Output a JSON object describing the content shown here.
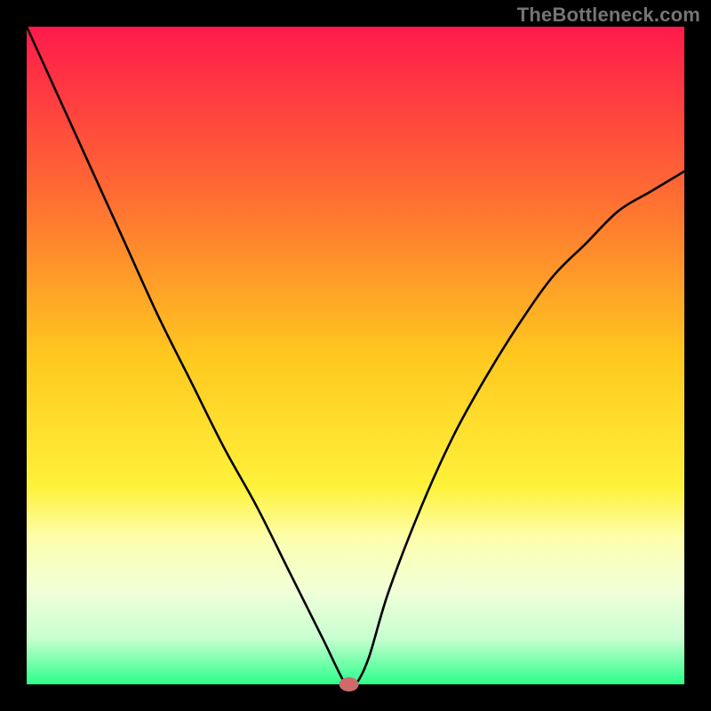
{
  "attribution": "TheBottleneck.com",
  "chart_data": {
    "type": "line",
    "title": "",
    "xlabel": "",
    "ylabel": "",
    "xlim": [
      0,
      100
    ],
    "ylim": [
      0,
      100
    ],
    "x": [
      0,
      5,
      10,
      15,
      20,
      25,
      30,
      35,
      40,
      45,
      48.5,
      50,
      52,
      55,
      60,
      65,
      70,
      75,
      80,
      85,
      90,
      95,
      100
    ],
    "values": [
      100,
      89,
      78,
      67,
      56,
      46,
      36,
      27,
      17,
      7,
      0,
      0,
      4,
      14,
      27,
      38,
      47,
      55,
      62,
      67,
      72,
      75,
      78
    ],
    "marker": {
      "x": 49,
      "y": 0
    },
    "gradient_stops": [
      {
        "pos": 0.0,
        "color": "#ff1a4b"
      },
      {
        "pos": 0.25,
        "color": "#ff6a33"
      },
      {
        "pos": 0.5,
        "color": "#ffc81f"
      },
      {
        "pos": 0.7,
        "color": "#fff23a"
      },
      {
        "pos": 0.78,
        "color": "#fdffb0"
      },
      {
        "pos": 0.86,
        "color": "#f0ffd8"
      },
      {
        "pos": 0.93,
        "color": "#c8ffd0"
      },
      {
        "pos": 1.0,
        "color": "#2bff8a"
      }
    ],
    "plot_border_px": 30,
    "curve_stroke": "#000000",
    "curve_stroke_width": 2.6,
    "marker_fill": "#cf6a6a"
  }
}
